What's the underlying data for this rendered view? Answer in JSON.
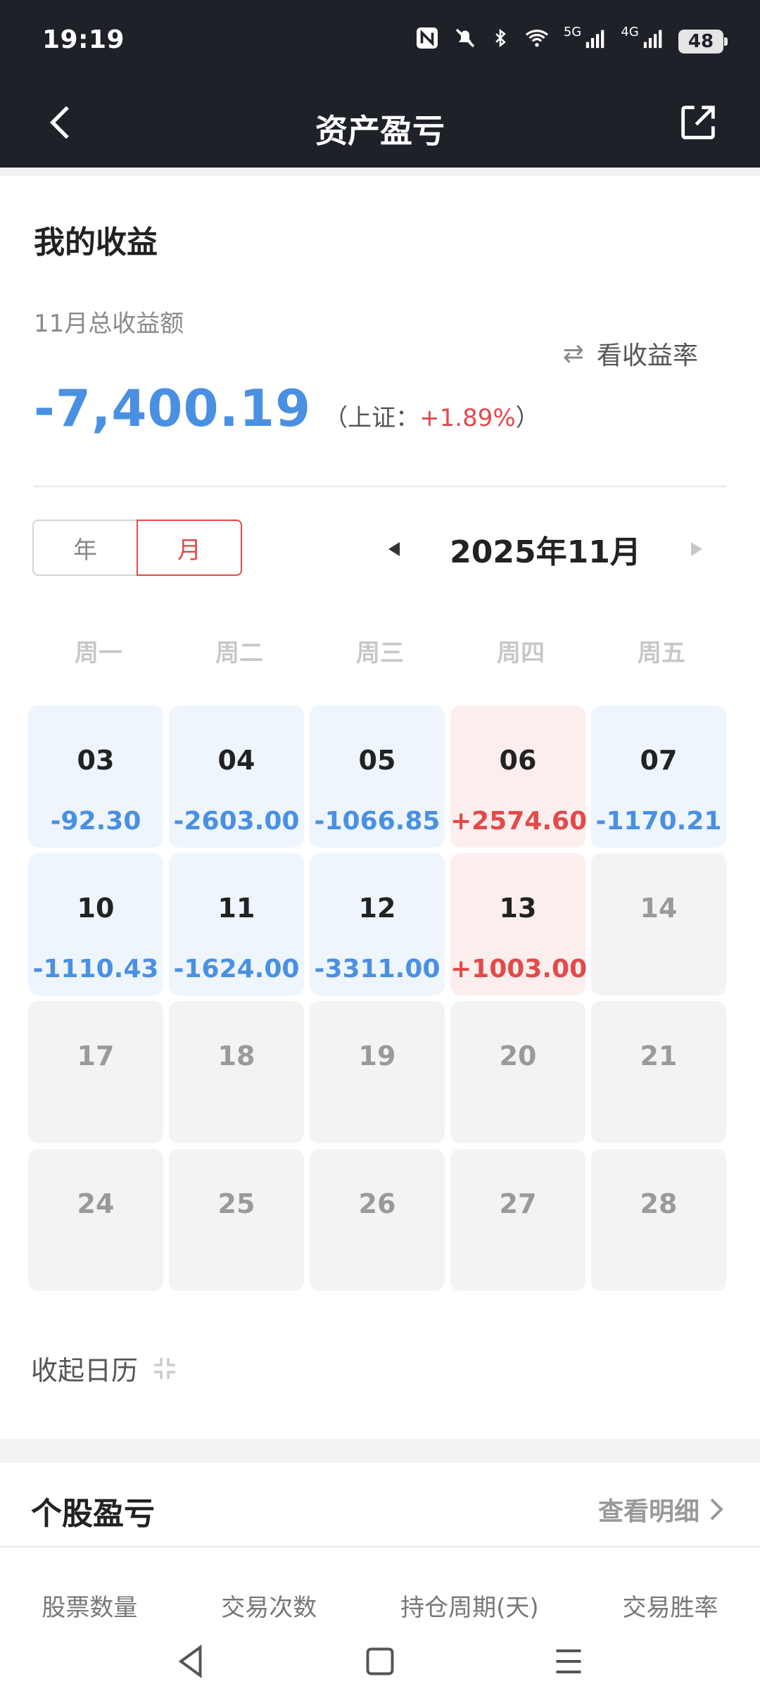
{
  "status_bar": {
    "time": "19:19",
    "icons": [
      "nfc-icon",
      "mute-icon",
      "bluetooth-icon",
      "wifi-icon",
      "signal-5g-icon",
      "signal-4g-icon"
    ],
    "net1": "5G",
    "net2": "4G",
    "battery": "48"
  },
  "nav": {
    "title": "资产盈亏"
  },
  "summary": {
    "section_title": "我的收益",
    "label": "11月总收益额",
    "toggle_label": "看收益率",
    "total": "-7,400.19",
    "bench_prefix": "（上证：",
    "bench_value": "+1.89%",
    "bench_suffix": "）"
  },
  "period": {
    "year_label": "年",
    "month_label": "月",
    "current": "2025年11月"
  },
  "weekdays": [
    "周一",
    "周二",
    "周三",
    "周四",
    "周五"
  ],
  "calendar": [
    {
      "day": "03",
      "value": "-92.30",
      "type": "neg"
    },
    {
      "day": "04",
      "value": "-2603.00",
      "type": "neg"
    },
    {
      "day": "05",
      "value": "-1066.85",
      "type": "neg"
    },
    {
      "day": "06",
      "value": "+2574.60",
      "type": "pos"
    },
    {
      "day": "07",
      "value": "-1170.21",
      "type": "neg"
    },
    {
      "day": "10",
      "value": "-1110.43",
      "type": "neg"
    },
    {
      "day": "11",
      "value": "-1624.00",
      "type": "neg"
    },
    {
      "day": "12",
      "value": "-3311.00",
      "type": "neg"
    },
    {
      "day": "13",
      "value": "+1003.00",
      "type": "pos"
    },
    {
      "day": "14",
      "value": "",
      "type": "none"
    },
    {
      "day": "17",
      "value": "",
      "type": "none"
    },
    {
      "day": "18",
      "value": "",
      "type": "none"
    },
    {
      "day": "19",
      "value": "",
      "type": "none"
    },
    {
      "day": "20",
      "value": "",
      "type": "none"
    },
    {
      "day": "21",
      "value": "",
      "type": "none"
    },
    {
      "day": "24",
      "value": "",
      "type": "none"
    },
    {
      "day": "25",
      "value": "",
      "type": "none"
    },
    {
      "day": "26",
      "value": "",
      "type": "none"
    },
    {
      "day": "27",
      "value": "",
      "type": "none"
    },
    {
      "day": "28",
      "value": "",
      "type": "none"
    }
  ],
  "collapse": {
    "label": "收起日历"
  },
  "stocks": {
    "title": "个股盈亏",
    "detail_label": "查看明细",
    "columns": [
      "股票数量",
      "交易次数",
      "持仓周期(天)",
      "交易胜率"
    ]
  },
  "colors": {
    "negative": "#4a90e2",
    "positive": "#e24a4a",
    "header_bg": "#1f2129"
  }
}
